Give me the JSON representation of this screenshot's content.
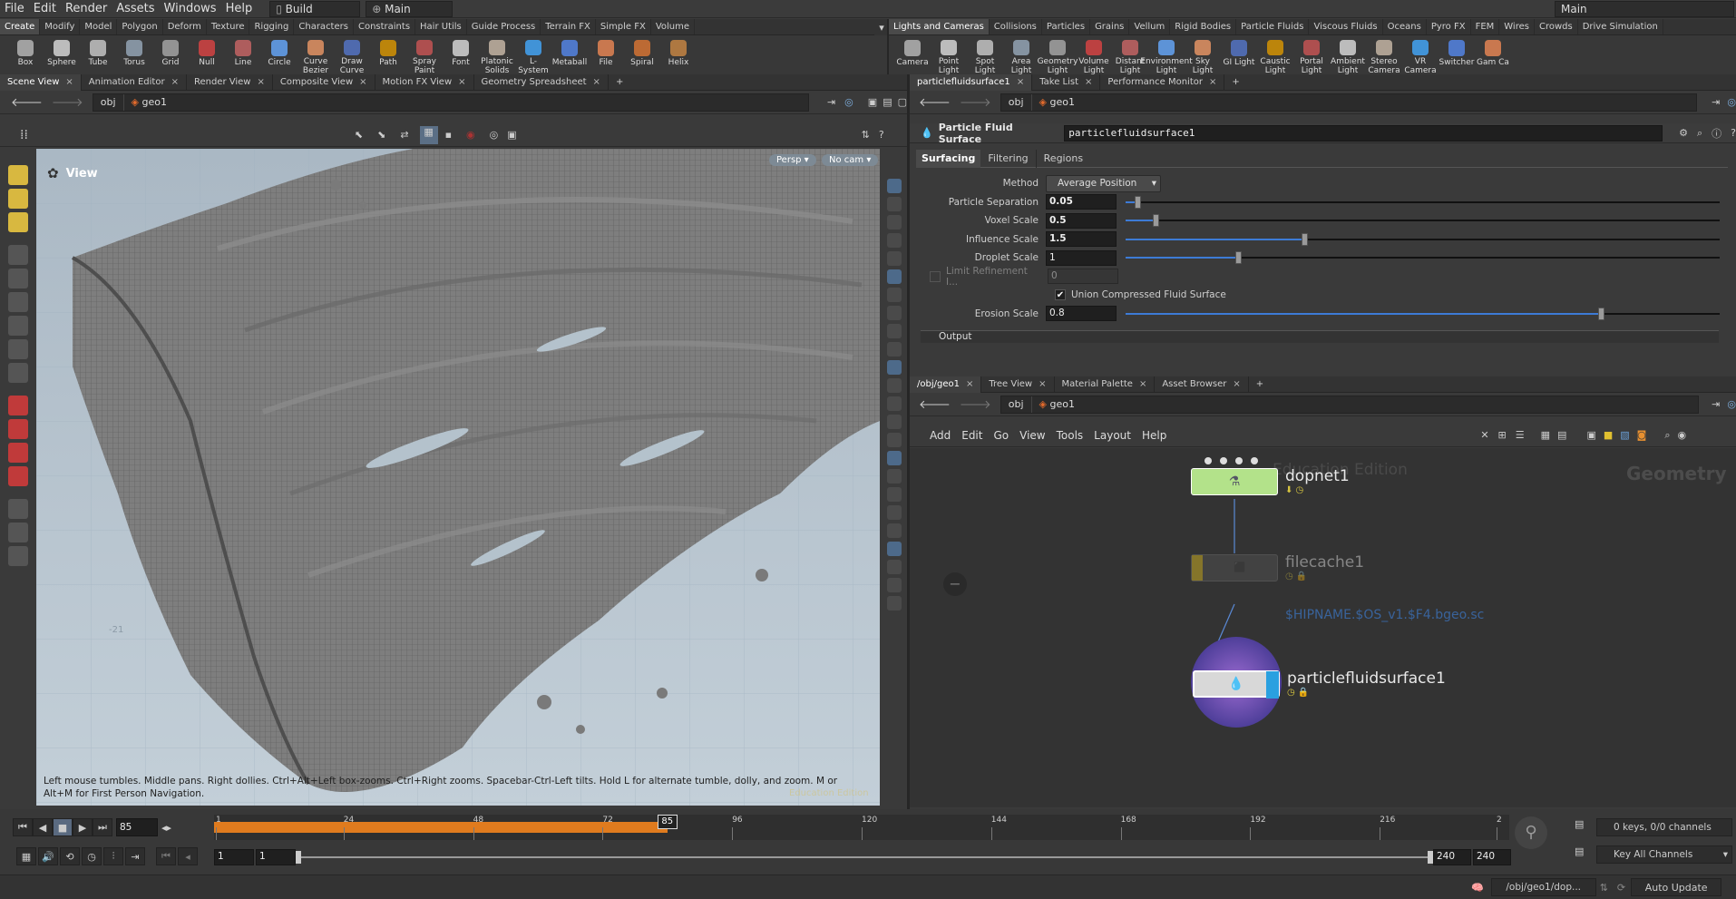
{
  "menubar": {
    "items": [
      "File",
      "Edit",
      "Render",
      "Assets",
      "Windows",
      "Help"
    ],
    "desktop": "Build",
    "context": "Main",
    "right_desktop": "Main"
  },
  "shelf_left": {
    "tabs": [
      "Create",
      "Modify",
      "Model",
      "Polygon",
      "Deform",
      "Texture",
      "Rigging",
      "Characters",
      "Constraints",
      "Hair Utils",
      "Guide Process",
      "Terrain FX",
      "Simple FX",
      "Volume"
    ],
    "tools": [
      "Box",
      "Sphere",
      "Tube",
      "Torus",
      "Grid",
      "Null",
      "Line",
      "Circle",
      "Curve Bezier",
      "Draw Curve",
      "Path",
      "Spray Paint",
      "Font",
      "Platonic Solids",
      "L-System",
      "Metaball",
      "File",
      "Spiral",
      "Helix"
    ]
  },
  "shelf_right": {
    "tabs": [
      "Lights and Cameras",
      "Collisions",
      "Particles",
      "Grains",
      "Vellum",
      "Rigid Bodies",
      "Particle Fluids",
      "Viscous Fluids",
      "Oceans",
      "Pyro FX",
      "FEM",
      "Wires",
      "Crowds",
      "Drive Simulation"
    ],
    "tools": [
      "Camera",
      "Point Light",
      "Spot Light",
      "Area Light",
      "Geometry Light",
      "Volume Light",
      "Distant Light",
      "Environment Light",
      "Sky Light",
      "GI Light",
      "Caustic Light",
      "Portal Light",
      "Ambient Light",
      "Stereo Camera",
      "VR Camera",
      "Switcher",
      "Gam Ca"
    ]
  },
  "left_pane": {
    "tabs": [
      "Scene View",
      "Animation Editor",
      "Render View",
      "Composite View",
      "Motion FX View",
      "Geometry Spreadsheet"
    ],
    "path": {
      "root": "obj",
      "node": "geo1"
    },
    "viewport": {
      "title": "View",
      "persp": "Persp",
      "cam": "No cam",
      "hint": "Left mouse tumbles. Middle pans. Right dollies. Ctrl+Alt+Left box-zooms. Ctrl+Right zooms. Spacebar-Ctrl-Left tilts. Hold L for alternate tumble, dolly, and zoom. M or Alt+M for First Person Navigation.",
      "watermark": "Education Edition",
      "grid_label": "-21"
    }
  },
  "params_pane": {
    "tabs": [
      "particlefluidsurface1",
      "Take List",
      "Performance Monitor"
    ],
    "path": {
      "root": "obj",
      "node": "geo1"
    },
    "node_type": "Particle Fluid Surface",
    "node_name": "particlefluidsurface1",
    "subtabs": [
      "Surfacing",
      "Filtering",
      "Regions"
    ],
    "method": {
      "label": "Method",
      "value": "Average Position"
    },
    "params": [
      {
        "label": "Particle Separation",
        "value": "0.05",
        "slider": 0.02
      },
      {
        "label": "Voxel Scale",
        "value": "0.5",
        "slider": 0.05
      },
      {
        "label": "Influence Scale",
        "value": "1.5",
        "slider": 0.3
      },
      {
        "label": "Droplet Scale",
        "value": "1",
        "slider": 0.19
      }
    ],
    "limit_refinement": {
      "label": "Limit Refinement I...",
      "value": "0"
    },
    "union": {
      "label": "Union Compressed Fluid Surface",
      "checked": "✔"
    },
    "erosion": {
      "label": "Erosion Scale",
      "value": "0.8",
      "slider": 0.8
    },
    "output_label": "Output"
  },
  "network_pane": {
    "tabs": [
      "/obj/geo1",
      "Tree View",
      "Material Palette",
      "Asset Browser"
    ],
    "path": {
      "root": "obj",
      "node": "geo1"
    },
    "menu": [
      "Add",
      "Edit",
      "Go",
      "View",
      "Tools",
      "Layout",
      "Help"
    ],
    "bg_label": "Geometry",
    "bg_edition": "Education Edition",
    "nodes": {
      "dop": "dopnet1",
      "cache": "filecache1",
      "cache_path": "$HIPNAME.$OS_v1.$F4.bgeo.sc",
      "surface": "particlefluidsurface1"
    }
  },
  "timeline": {
    "frame": "85",
    "marker": "85",
    "ticks": [
      "1",
      "24",
      "48",
      "72",
      "96",
      "120",
      "144",
      "168",
      "192",
      "216",
      "2"
    ],
    "start": "1",
    "start2": "1",
    "end": "240",
    "end2": "240",
    "keys": "0 keys, 0/0 channels",
    "key_all": "Key All Channels",
    "progress": 0.35
  },
  "statusbar": {
    "path": "/obj/geo1/dop...",
    "update": "Auto Update"
  },
  "colors": {
    "accent": "#3d7bd6",
    "orange": "#e07b1e",
    "dop_green": "#b3e28a",
    "cache_yellow": "#e8c520",
    "surface_blue": "#2aa0e0"
  }
}
